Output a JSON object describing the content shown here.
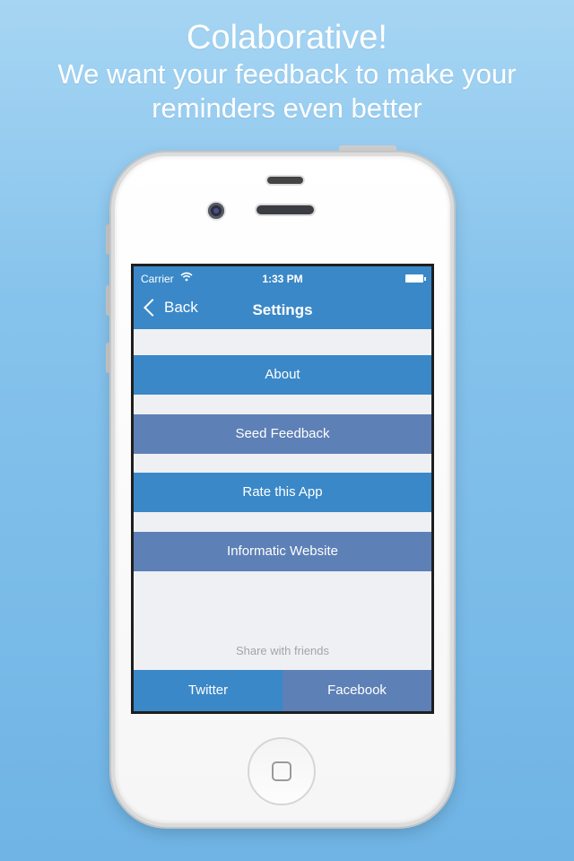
{
  "headline": {
    "title": "Colaborative!",
    "line1": "We want your feedback to make your",
    "line2": "reminders even better"
  },
  "statusbar": {
    "carrier": "Carrier",
    "wifi_icon": "wifi-icon",
    "time": "1:33 PM",
    "battery_icon": "battery-icon"
  },
  "navbar": {
    "back_label": "Back",
    "title": "Settings"
  },
  "menu": {
    "items": [
      {
        "label": "About",
        "color": "#3a88c8"
      },
      {
        "label": "Seed Feedback",
        "color": "#5d80b6"
      },
      {
        "label": "Rate this App",
        "color": "#3a88c8"
      },
      {
        "label": "Informatic Website",
        "color": "#5d80b6"
      }
    ]
  },
  "share": {
    "label": "Share with friends",
    "twitter": "Twitter",
    "facebook": "Facebook"
  },
  "colors": {
    "primary": "#3a88c8",
    "secondary": "#5d80b6",
    "screen_bg": "#eff0f4"
  }
}
